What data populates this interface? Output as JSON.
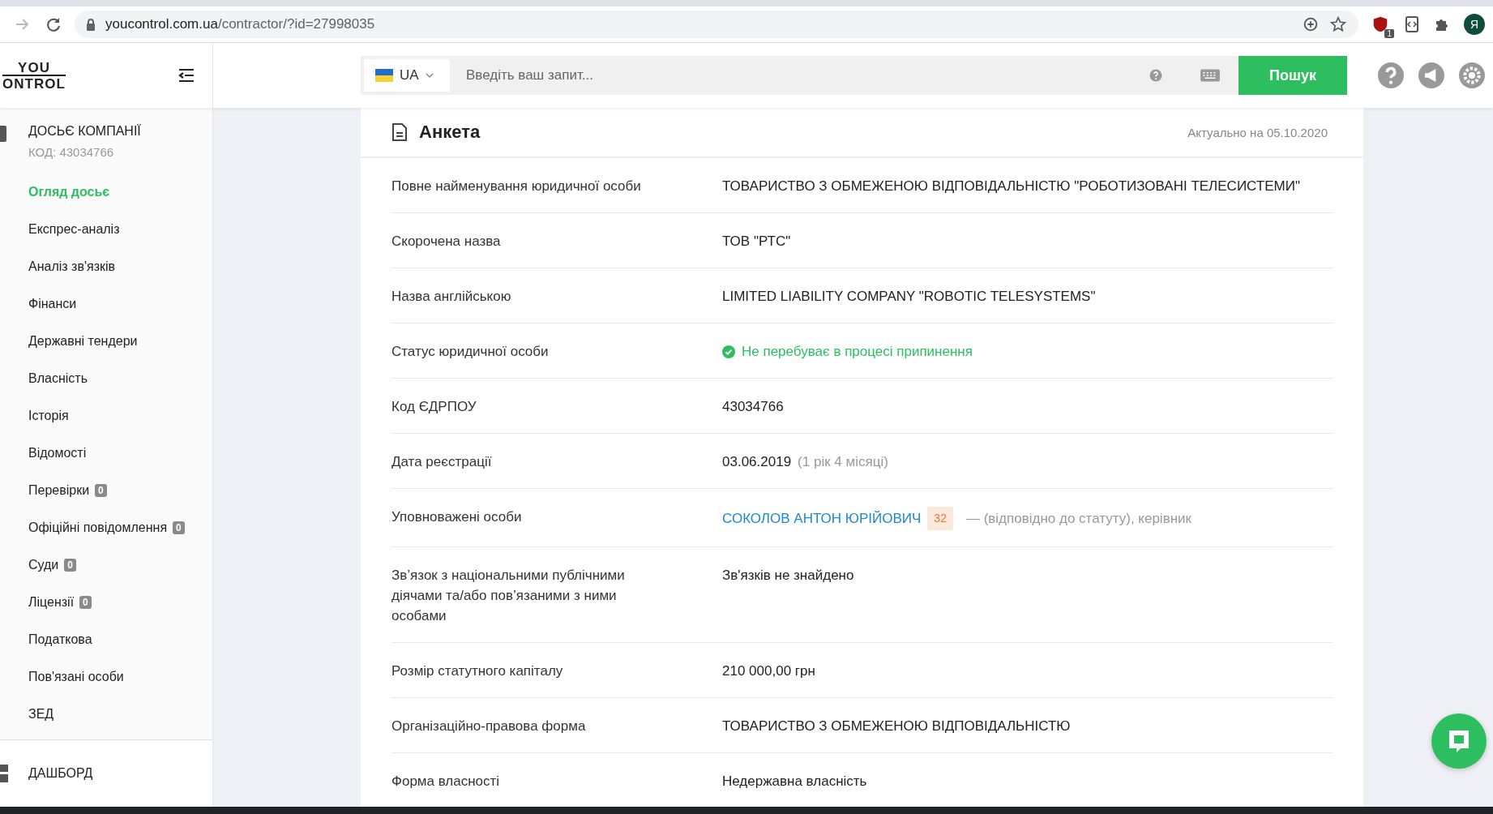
{
  "browser": {
    "url_host": "youcontrol.com.ua",
    "url_path": "/contractor/?id=27998035",
    "extension_badge": "1",
    "profile_initial": "Я"
  },
  "header": {
    "logo_top": "YOU",
    "logo_bottom": "ONTROL",
    "language": "UA",
    "search_placeholder": "Введіть ваш запит...",
    "search_button": "Пошук"
  },
  "sidebar": {
    "title": "ДОСЬЄ КОМПАНІЇ",
    "code": "КОД: 43034766",
    "items": [
      {
        "label": "Огляд досьє",
        "selected": true
      },
      {
        "label": "Експрес-аналіз",
        "selected": false
      },
      {
        "label": "Аналіз зв'язків",
        "selected": false
      },
      {
        "label": "Фінанси",
        "selected": false
      },
      {
        "label": "Державні тендери",
        "selected": false
      },
      {
        "label": "Власність",
        "selected": false
      },
      {
        "label": "Історія",
        "selected": false
      },
      {
        "label": "Відомості",
        "selected": false
      },
      {
        "label": "Перевірки",
        "selected": false,
        "count": "0"
      },
      {
        "label": "Офіційні повідомлення",
        "selected": false,
        "count": "0"
      },
      {
        "label": "Суди",
        "selected": false,
        "count": "0"
      },
      {
        "label": "Ліцензії",
        "selected": false,
        "count": "0"
      },
      {
        "label": "Податкова",
        "selected": false
      },
      {
        "label": "Пов'язані особи",
        "selected": false
      },
      {
        "label": "ЗЕД",
        "selected": false
      }
    ],
    "dashboard": "ДАШБОРД"
  },
  "card": {
    "title": "Анкета",
    "updated": "Актуально на 05.10.2020",
    "rows": [
      {
        "kind": "text",
        "label": "Повне найменування юридичної особи",
        "value": "ТОВАРИСТВО З ОБМЕЖЕНОЮ ВІДПОВІДАЛЬНІСТЮ \"РОБОТИЗОВАНІ ТЕЛЕСИСТЕМИ\""
      },
      {
        "kind": "text",
        "label": "Скорочена назва",
        "value": "ТОВ \"РТС\""
      },
      {
        "kind": "text",
        "label": "Назва англійською",
        "value": "LIMITED LIABILITY COMPANY \"ROBOTIC TELESYSTEMS\""
      },
      {
        "kind": "status",
        "label": "Статус юридичної особи",
        "value": "Не перебуває в процесі припинення"
      },
      {
        "kind": "text",
        "label": "Код ЄДРПОУ",
        "value": "43034766"
      },
      {
        "kind": "date",
        "label": "Дата реєстрації",
        "value": "03.06.2019",
        "note": "(1 рік 4 місяці)"
      },
      {
        "kind": "person",
        "label": "Уповноважені особи",
        "value": "СОКОЛОВ АНТОН ЮРІЙОВИЧ",
        "count": "32",
        "note": "— (відповідно до статуту), керівник"
      },
      {
        "kind": "text",
        "label": "Зв’язок з національними публічними діячами та/або пов’язаними з ними особами",
        "value": "Зв'язків не знайдено"
      },
      {
        "kind": "text",
        "label": "Розмір статутного капіталу",
        "value": "210 000,00 грн"
      },
      {
        "kind": "text",
        "label": "Організаційно-правова форма",
        "value": "ТОВАРИСТВО З ОБМЕЖЕНОЮ ВІДПОВІДАЛЬНІСТЮ"
      },
      {
        "kind": "text",
        "label": "Форма власності",
        "value": "Недержавна власність"
      }
    ]
  }
}
